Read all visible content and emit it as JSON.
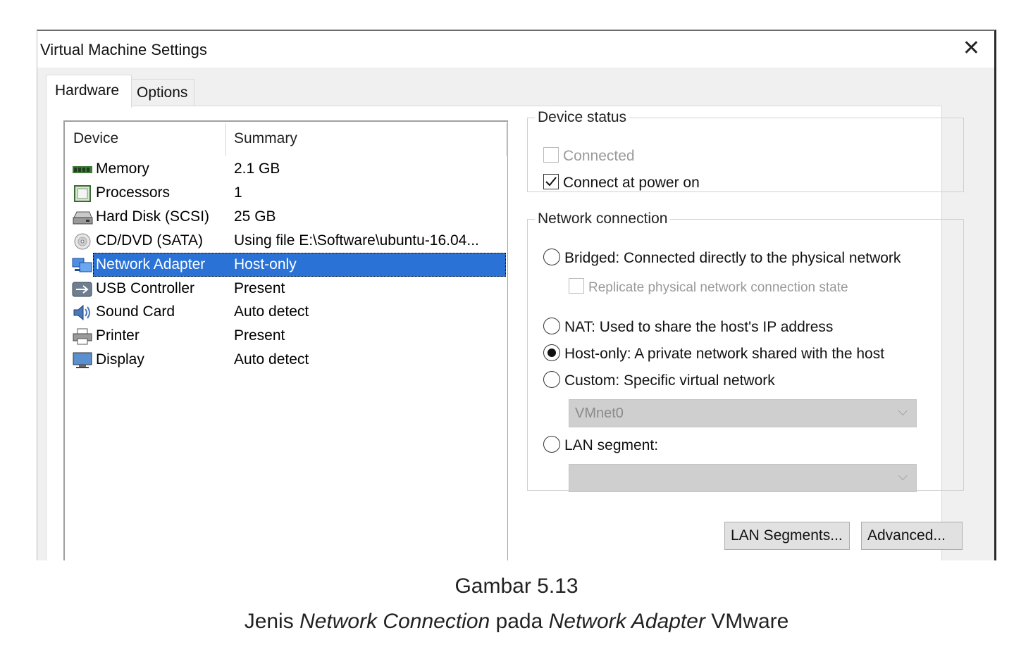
{
  "window": {
    "title": "Virtual Machine Settings"
  },
  "tabs": [
    {
      "label": "Hardware"
    },
    {
      "label": "Options"
    }
  ],
  "device_list": {
    "headers": {
      "device": "Device",
      "summary": "Summary"
    },
    "rows": [
      {
        "name": "Memory",
        "summary": "2.1 GB",
        "icon": "memory-icon"
      },
      {
        "name": "Processors",
        "summary": "1",
        "icon": "processor-icon"
      },
      {
        "name": "Hard Disk (SCSI)",
        "summary": "25 GB",
        "icon": "hard-disk-icon"
      },
      {
        "name": "CD/DVD (SATA)",
        "summary": "Using file E:\\Software\\ubuntu-16.04...",
        "icon": "cd-dvd-icon"
      },
      {
        "name": "Network Adapter",
        "summary": "Host-only",
        "icon": "network-adapter-icon",
        "selected": true
      },
      {
        "name": "USB Controller",
        "summary": "Present",
        "icon": "usb-icon"
      },
      {
        "name": "Sound Card",
        "summary": "Auto detect",
        "icon": "sound-card-icon"
      },
      {
        "name": "Printer",
        "summary": "Present",
        "icon": "printer-icon"
      },
      {
        "name": "Display",
        "summary": "Auto detect",
        "icon": "display-icon"
      }
    ]
  },
  "device_status": {
    "legend": "Device status",
    "connected": {
      "label": "Connected",
      "checked": false,
      "disabled": true
    },
    "connect_at_power_on": {
      "label": "Connect at power on",
      "checked": true
    }
  },
  "network_connection": {
    "legend": "Network connection",
    "bridged": "Bridged: Connected directly to the physical network",
    "replicate": "Replicate physical network connection state",
    "nat": "NAT: Used to share the host's IP address",
    "host_only": "Host-only: A private network shared with the host",
    "custom": "Custom: Specific virtual network",
    "custom_select_value": "VMnet0",
    "lan_segment": "LAN segment:",
    "lan_segment_select_value": "",
    "selected": "host_only"
  },
  "buttons": {
    "lan_segments": "LAN Segments...",
    "advanced": "Advanced..."
  },
  "caption": {
    "line1": "Gambar 5.13",
    "line2_a": "Jenis ",
    "line2_b": "Network Connection",
    "line2_c": " pada ",
    "line2_d": "Network Adapter",
    "line2_e": " VMware"
  },
  "colors": {
    "selection": "#2a72d6",
    "window_bg": "#f0f0f0"
  }
}
